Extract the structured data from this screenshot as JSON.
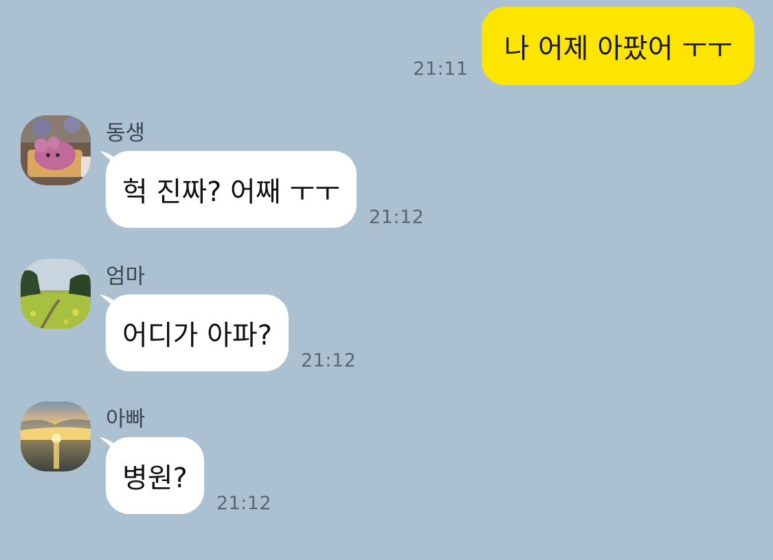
{
  "colors": {
    "background": "#abc1d1",
    "outgoing_bubble": "#fee500",
    "incoming_bubble": "#ffffff",
    "time_text": "#5a6671"
  },
  "outgoing": {
    "text": "나 어제 아팠어 ㅜㅜ",
    "time": "21:11"
  },
  "incoming": [
    {
      "sender": "동생",
      "avatar_icon": "teddy-bear-cake-photo",
      "text": "헉 진짜? 어째 ㅜㅜ",
      "time": "21:12"
    },
    {
      "sender": "엄마",
      "avatar_icon": "green-field-landscape-photo",
      "text": "어디가 아파?",
      "time": "21:12"
    },
    {
      "sender": "아빠",
      "avatar_icon": "sunset-over-sea-photo",
      "text": "병원?",
      "time": "21:12"
    }
  ]
}
